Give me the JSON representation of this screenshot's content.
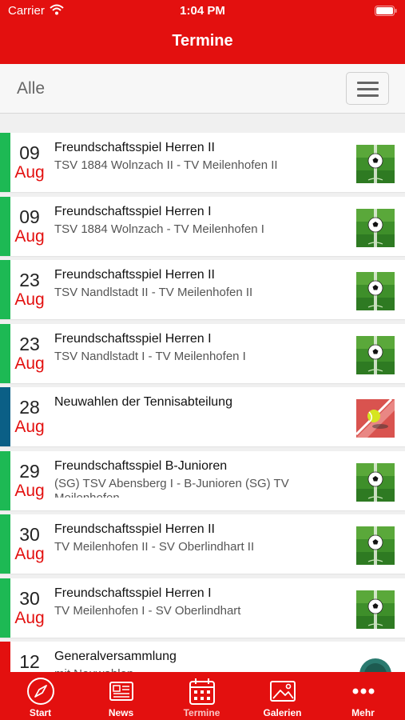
{
  "status": {
    "carrier": "Carrier",
    "time": "1:04 PM"
  },
  "nav": {
    "title": "Termine"
  },
  "filter": {
    "label": "Alle"
  },
  "colors": {
    "brand_red": "#e3100f",
    "football": "#1db954",
    "tennis": "#0b5f86"
  },
  "events": [
    {
      "day": "09",
      "month": "Aug",
      "title": "Freundschaftsspiel Herren II",
      "subtitle": "TSV 1884 Wolnzach II - TV Meilenhofen II",
      "category_color": "#1db954",
      "icon": "football-thumbnail"
    },
    {
      "day": "09",
      "month": "Aug",
      "title": "Freundschaftsspiel Herren I",
      "subtitle": "TSV 1884 Wolnzach - TV Meilenhofen I",
      "category_color": "#1db954",
      "icon": "football-thumbnail"
    },
    {
      "day": "23",
      "month": "Aug",
      "title": "Freundschaftsspiel Herren II",
      "subtitle": "TSV Nandlstadt II - TV Meilenhofen II",
      "category_color": "#1db954",
      "icon": "football-thumbnail"
    },
    {
      "day": "23",
      "month": "Aug",
      "title": "Freundschaftsspiel Herren I",
      "subtitle": "TSV Nandlstadt I - TV Meilenhofen I",
      "category_color": "#1db954",
      "icon": "football-thumbnail"
    },
    {
      "day": "28",
      "month": "Aug",
      "title": "Neuwahlen der Tennisabteilung",
      "subtitle": "",
      "category_color": "#0b5f86",
      "icon": "tennis-thumbnail"
    },
    {
      "day": "29",
      "month": "Aug",
      "title": "Freundschaftsspiel B-Junioren",
      "subtitle": "(SG) TSV Abensberg I - B-Junioren (SG) TV Meilenhofen",
      "category_color": "#1db954",
      "icon": "football-thumbnail"
    },
    {
      "day": "30",
      "month": "Aug",
      "title": "Freundschaftsspiel Herren II",
      "subtitle": "TV Meilenhofen II - SV Oberlindhart II",
      "category_color": "#1db954",
      "icon": "football-thumbnail"
    },
    {
      "day": "30",
      "month": "Aug",
      "title": "Freundschaftsspiel Herren I",
      "subtitle": "TV Meilenhofen I - SV Oberlindhart",
      "category_color": "#1db954",
      "icon": "football-thumbnail"
    },
    {
      "day": "12",
      "month": "",
      "title": "Generalversammlung",
      "subtitle": "mit Neuwahlen",
      "category_color": "#e3100f",
      "icon": "club-logo-thumbnail"
    }
  ],
  "tabs": [
    {
      "label": "Start",
      "icon": "compass-icon"
    },
    {
      "label": "News",
      "icon": "newspaper-icon"
    },
    {
      "label": "Termine",
      "icon": "calendar-icon"
    },
    {
      "label": "Galerien",
      "icon": "gallery-icon"
    },
    {
      "label": "Mehr",
      "icon": "more-icon"
    }
  ]
}
